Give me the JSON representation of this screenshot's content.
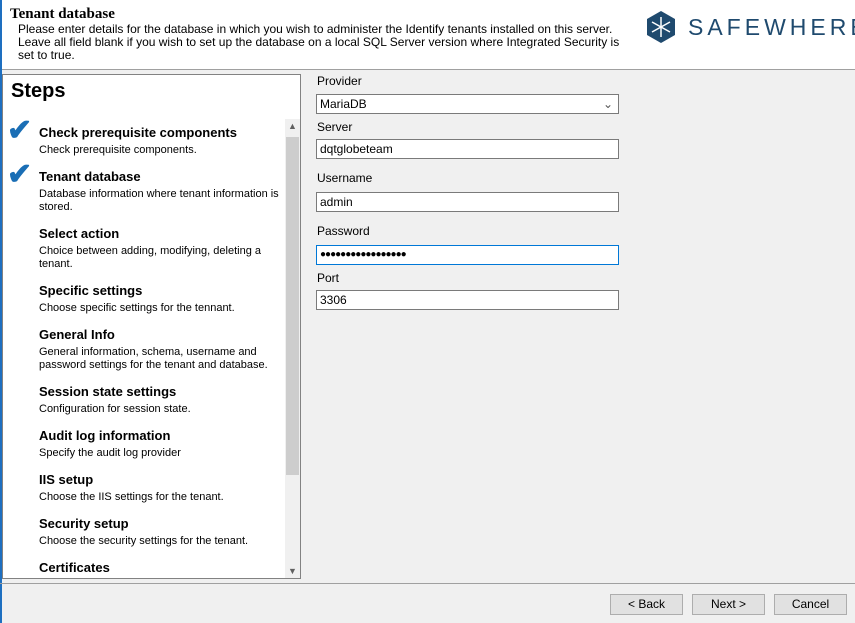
{
  "header": {
    "title": "Tenant database",
    "description": "Please enter details for the database in which you wish to administer the Identify tenants installed on this server. Leave all field blank if you wish to set up the database on a local SQL Server version where Integrated Security is set to true.",
    "logo_text": "SAFEWHERE",
    "brand_color": "#1f4a6e"
  },
  "steps": {
    "title": "Steps",
    "items": [
      {
        "name": "Check prerequisite components",
        "desc": "Check prerequisite components.",
        "done": true
      },
      {
        "name": "Tenant database",
        "desc": "Database information where tenant information is stored.",
        "done": true
      },
      {
        "name": "Select action",
        "desc": "Choice between adding, modifying, deleting a tenant.",
        "done": false
      },
      {
        "name": "Specific settings",
        "desc": "Choose specific settings for the tennant.",
        "done": false
      },
      {
        "name": "General Info",
        "desc": "General information, schema, username and password settings for the tenant and database.",
        "done": false
      },
      {
        "name": "Session state settings",
        "desc": "Configuration for session state.",
        "done": false
      },
      {
        "name": "Audit log information",
        "desc": "Specify the audit log provider",
        "done": false
      },
      {
        "name": "IIS setup",
        "desc": "Choose the IIS settings for the tenant.",
        "done": false
      },
      {
        "name": "Security setup",
        "desc": "Choose the security settings for the tenant.",
        "done": false
      },
      {
        "name": "Certificates",
        "desc": "",
        "done": false
      }
    ]
  },
  "form": {
    "provider_label": "Provider",
    "provider_value": "MariaDB",
    "server_label": "Server",
    "server_value": "dqtglobeteam",
    "username_label": "Username",
    "username_value": "admin",
    "password_label": "Password",
    "password_value": "●●●●●●●●●●●●●●●●●",
    "port_label": "Port",
    "port_value": "3306"
  },
  "buttons": {
    "back": "< Back",
    "next": "Next >",
    "cancel": "Cancel"
  }
}
